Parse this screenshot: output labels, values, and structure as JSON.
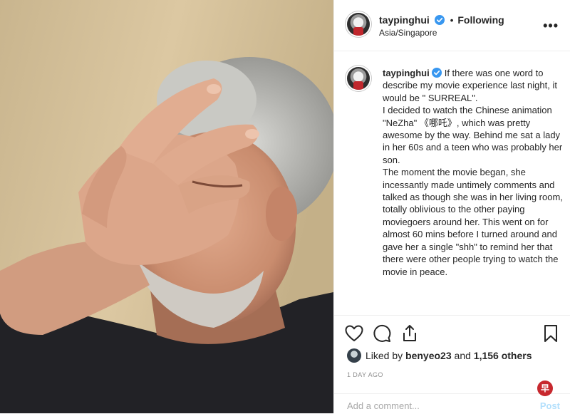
{
  "photo": {
    "subject": "man-facepalm-photo"
  },
  "header": {
    "username": "taypinghui",
    "separator": "•",
    "follow_status": "Following",
    "location": "Asia/Singapore",
    "more_icon": "more-horizontal-icon",
    "more_glyph": "•••"
  },
  "caption": {
    "username": "taypinghui",
    "text": "If there was one word to describe my movie experience last night, it would be \" SURREAL\".\nI decided to watch the Chinese animation \"NeZha\" 《哪吒》, which was pretty awesome by the way. Behind me sat a lady in her 60s and a teen who was probably her son.\nThe moment the movie began, she incessantly made untimely comments and talked as though she was in her living room, totally oblivious to the other paying moviegoers around her. This went on for almost 60 mins before I turned around and gave her a single \"shh\" to remind her that there were other people trying to watch the movie in peace."
  },
  "actions": {
    "like_icon": "heart-icon",
    "comment_icon": "comment-bubble-icon",
    "share_icon": "share-icon",
    "save_icon": "bookmark-icon"
  },
  "likes": {
    "prefix": "Liked by",
    "user": "benyeo23",
    "conjunction": "and",
    "others": "1,156 others"
  },
  "date": "1 DAY AGO",
  "comment": {
    "placeholder": "Add a comment...",
    "post_label": "Post"
  },
  "watermark": {
    "glyph": "早"
  },
  "colors": {
    "verified": "#3897f0",
    "post_disabled": "#b2dffc",
    "divider": "#efefef"
  }
}
